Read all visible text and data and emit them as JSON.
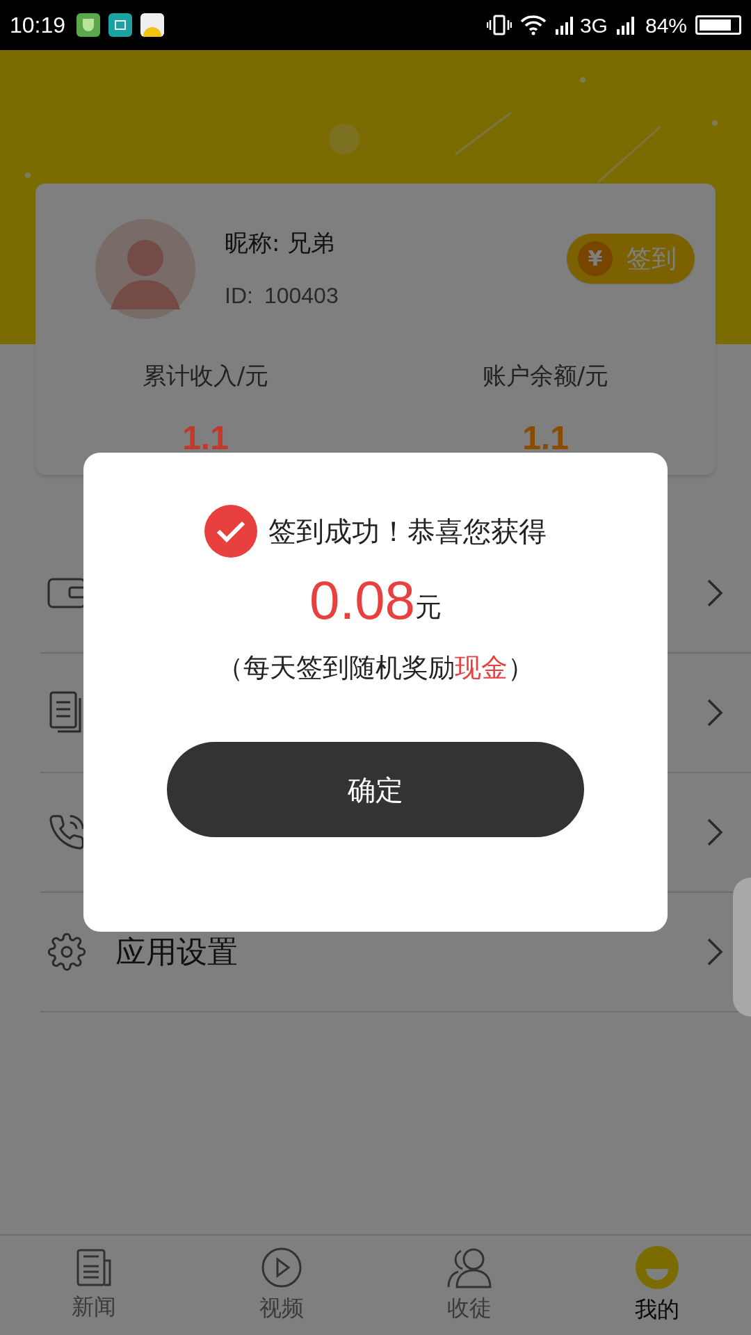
{
  "status_bar": {
    "time": "10:19",
    "network": "3G",
    "battery": "84%"
  },
  "profile": {
    "nickname": "昵称: 兄弟",
    "id_label": "ID:",
    "id": "100403",
    "sign_button": {
      "symbol": "¥",
      "label": "签到"
    }
  },
  "stats": [
    {
      "label": "累计收入/元",
      "value": "1.1",
      "color": "#c0392b"
    },
    {
      "label": "账户余额/元",
      "value": "1.1",
      "color": "#8a4a00"
    }
  ],
  "menu": [
    {
      "kind": "wallet"
    },
    {
      "kind": "document"
    },
    {
      "kind": "phone"
    },
    {
      "kind": "settings",
      "label": "应用设置"
    }
  ],
  "nav": [
    {
      "label": "新闻",
      "kind": "news",
      "selected": false
    },
    {
      "label": "视频",
      "kind": "video",
      "selected": false
    },
    {
      "label": "收徒",
      "kind": "people",
      "selected": false
    },
    {
      "label": "我的",
      "kind": "me",
      "selected": true
    }
  ],
  "dialog": {
    "title": "签到成功！恭喜您获得",
    "amount": "0.08",
    "unit": "元",
    "note_before": "（每天签到随机奖励",
    "note_highlight": "现金",
    "note_after": "）",
    "button": "确定"
  }
}
